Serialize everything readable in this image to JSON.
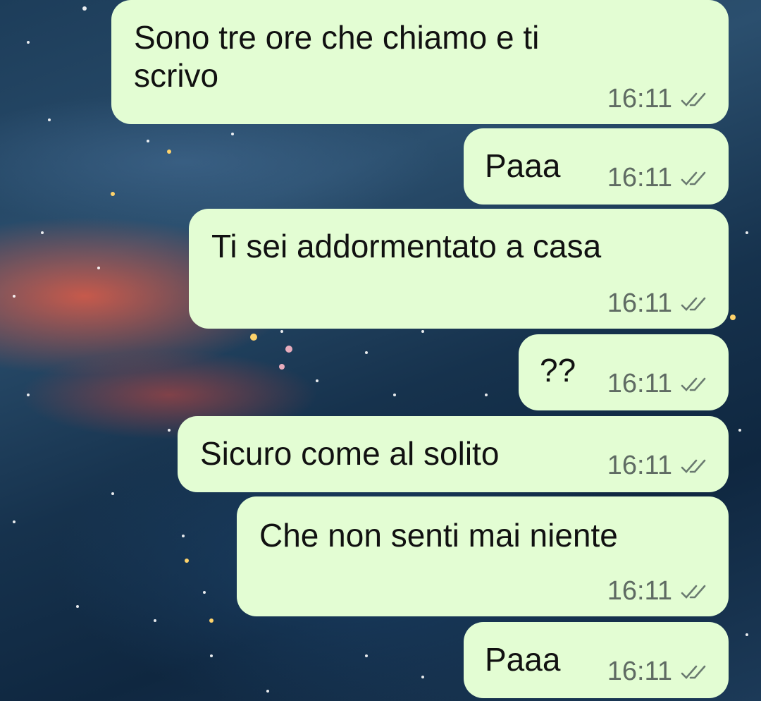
{
  "chat": {
    "messages": [
      {
        "text": "Sono tre ore che chiamo e ti scrivo",
        "line1": "Sono tre ore che chiamo e ti",
        "line2": "scrivo",
        "time": "16:11",
        "status": "read-double-check"
      },
      {
        "text": "Paaa",
        "time": "16:11",
        "status": "read-double-check"
      },
      {
        "text": "Ti sei addormentato a casa",
        "time": "16:11",
        "status": "read-double-check"
      },
      {
        "text": "??",
        "time": "16:11",
        "status": "read-double-check"
      },
      {
        "text": "Sicuro come al solito",
        "time": "16:11",
        "status": "read-double-check"
      },
      {
        "text": "Che non senti mai niente",
        "time": "16:11",
        "status": "read-double-check"
      },
      {
        "text": "Paaa",
        "time": "16:11",
        "status": "read-double-check"
      }
    ]
  },
  "colors": {
    "bubble": "#e3fdd3",
    "text": "#111111",
    "meta": "#5f6b63"
  },
  "icons": {
    "status": "double-check-icon"
  }
}
